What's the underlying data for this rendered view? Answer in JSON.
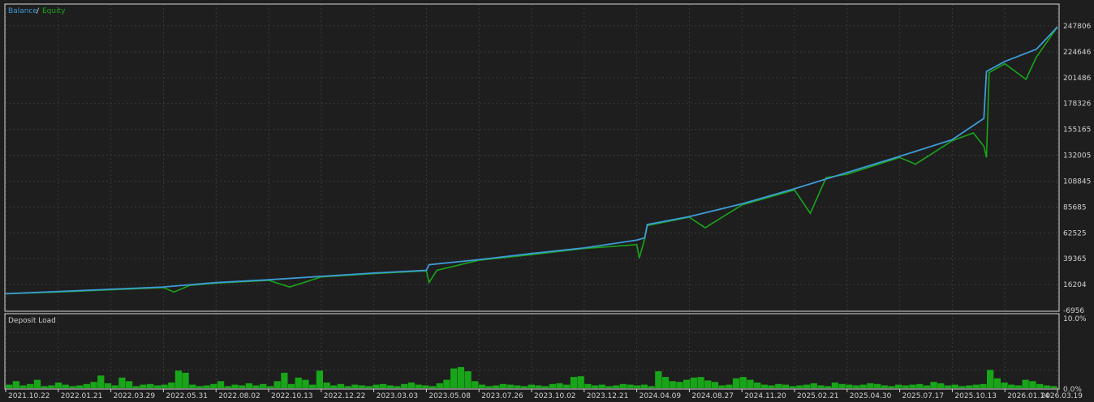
{
  "legend": {
    "balance_label": "Balance",
    "separator": "/",
    "equity_label": "Equity",
    "balance_color": "#3d9bd8",
    "equity_color": "#19a519"
  },
  "deposit_panel": {
    "title": "Deposit Load",
    "top_label": "10.0%",
    "bottom_label": "0.0%",
    "bar_color": "#19a519"
  },
  "colors": {
    "background": "#1e1e1e",
    "plot_background": "#1e1e1e",
    "grid": "#3a3a3a",
    "border": "#d8d8d8",
    "text": "#d0d0d0"
  },
  "chart_data": [
    {
      "type": "line",
      "title": "",
      "grid": true,
      "legend_position": "top-left",
      "x_ticks": [
        "2021.10.22",
        "2022.01.21",
        "2022.03.29",
        "2022.05.31",
        "2022.08.02",
        "2022.10.13",
        "2022.12.22",
        "2023.03.03",
        "2023.05.08",
        "2023.07.26",
        "2023.10.02",
        "2023.12.21",
        "2024.04.09",
        "2024.08.27",
        "2024.11.20",
        "2025.02.21",
        "2025.04.30",
        "2025.07.17",
        "2025.10.13",
        "2026.01.14",
        "2026.03.19"
      ],
      "y_ticks": [
        -6956,
        16204,
        39365,
        62525,
        85685,
        108845,
        132005,
        155165,
        178326,
        201486,
        224646,
        247806
      ],
      "ylim": [
        -6956,
        257000
      ],
      "series": [
        {
          "name": "Balance",
          "x_index": [
            0,
            1,
            2,
            3,
            3.5,
            4,
            5,
            6,
            7,
            8,
            8.05,
            9,
            10,
            11,
            12,
            12.15,
            12.2,
            13,
            14,
            15,
            16,
            17,
            18,
            18.6,
            18.65,
            19,
            19.6,
            20
          ],
          "values": [
            8000,
            10000,
            12000,
            14000,
            16000,
            18000,
            20500,
            23500,
            26500,
            29000,
            34000,
            38500,
            44000,
            49000,
            56000,
            58000,
            70000,
            77000,
            88500,
            102000,
            116500,
            131000,
            146000,
            165000,
            207000,
            216000,
            227000,
            247000
          ]
        },
        {
          "name": "Equity",
          "x_index": [
            0,
            1,
            2,
            3,
            3.2,
            3.5,
            4,
            5,
            5.4,
            6,
            7,
            8,
            8.05,
            8.2,
            9,
            10,
            11,
            12,
            12.05,
            12.15,
            12.2,
            13,
            13.3,
            14,
            15,
            15.3,
            15.6,
            16,
            17,
            17.3,
            18,
            18.4,
            18.6,
            18.65,
            18.7,
            19,
            19.4,
            19.6,
            20
          ],
          "values": [
            8000,
            9500,
            11500,
            13500,
            9500,
            15500,
            17500,
            20000,
            14000,
            23000,
            26000,
            28500,
            18000,
            29000,
            38000,
            43000,
            48500,
            52000,
            40000,
            57000,
            69000,
            76500,
            67000,
            87500,
            101000,
            80000,
            112000,
            115000,
            130000,
            124000,
            145000,
            152000,
            140000,
            130000,
            206000,
            214000,
            200000,
            220000,
            247000
          ]
        }
      ]
    },
    {
      "type": "bar",
      "title": "Deposit Load",
      "ylim": [
        0,
        10
      ],
      "x_ticks": [
        "2021.10.22",
        "2022.01.21",
        "2022.03.29",
        "2022.05.31",
        "2022.08.02",
        "2022.10.13",
        "2022.12.22",
        "2023.03.03",
        "2023.05.08",
        "2023.07.26",
        "2023.10.02",
        "2023.12.21",
        "2024.04.09",
        "2024.08.27",
        "2024.11.20",
        "2025.02.21",
        "2025.04.30",
        "2025.07.17",
        "2025.10.13",
        "2026.01.14",
        "2026.03.19"
      ],
      "series": [
        {
          "name": "Deposit Load",
          "values": [
            0.5,
            1.0,
            0.4,
            0.6,
            1.2,
            0.3,
            0.4,
            0.8,
            0.5,
            0.3,
            0.4,
            0.6,
            0.9,
            1.8,
            0.7,
            0.4,
            1.5,
            1.0,
            0.3,
            0.5,
            0.6,
            0.4,
            0.5,
            0.8,
            2.5,
            2.2,
            0.5,
            0.3,
            0.4,
            0.6,
            1.0,
            0.3,
            0.5,
            0.4,
            0.7,
            0.4,
            0.6,
            0.3,
            1.0,
            2.2,
            0.6,
            1.5,
            1.2,
            0.5,
            2.5,
            0.8,
            0.4,
            0.6,
            0.3,
            0.5,
            0.4,
            0.3,
            0.5,
            0.6,
            0.4,
            0.3,
            0.6,
            0.8,
            0.5,
            0.4,
            0.3,
            0.7,
            1.2,
            2.8,
            3.0,
            2.4,
            1.0,
            0.5,
            0.3,
            0.4,
            0.6,
            0.5,
            0.4,
            0.3,
            0.5,
            0.4,
            0.3,
            0.6,
            0.7,
            0.5,
            1.6,
            1.7,
            0.6,
            0.4,
            0.5,
            0.3,
            0.4,
            0.6,
            0.5,
            0.4,
            0.5,
            0.3,
            2.4,
            1.6,
            1.0,
            0.9,
            1.2,
            1.5,
            1.6,
            1.1,
            0.9,
            0.4,
            0.5,
            1.4,
            1.6,
            1.2,
            0.8,
            0.5,
            0.4,
            0.6,
            0.5,
            0.3,
            0.4,
            0.5,
            0.7,
            0.4,
            0.3,
            0.8,
            0.6,
            0.5,
            0.4,
            0.5,
            0.7,
            0.6,
            0.4,
            0.3,
            0.5,
            0.4,
            0.5,
            0.6,
            0.4,
            0.9,
            0.7,
            0.4,
            0.5,
            0.3,
            0.4,
            0.5,
            0.6,
            2.6,
            1.4,
            0.8,
            0.5,
            0.4,
            1.2,
            1.0,
            0.6,
            0.4,
            0.3
          ]
        }
      ]
    }
  ]
}
